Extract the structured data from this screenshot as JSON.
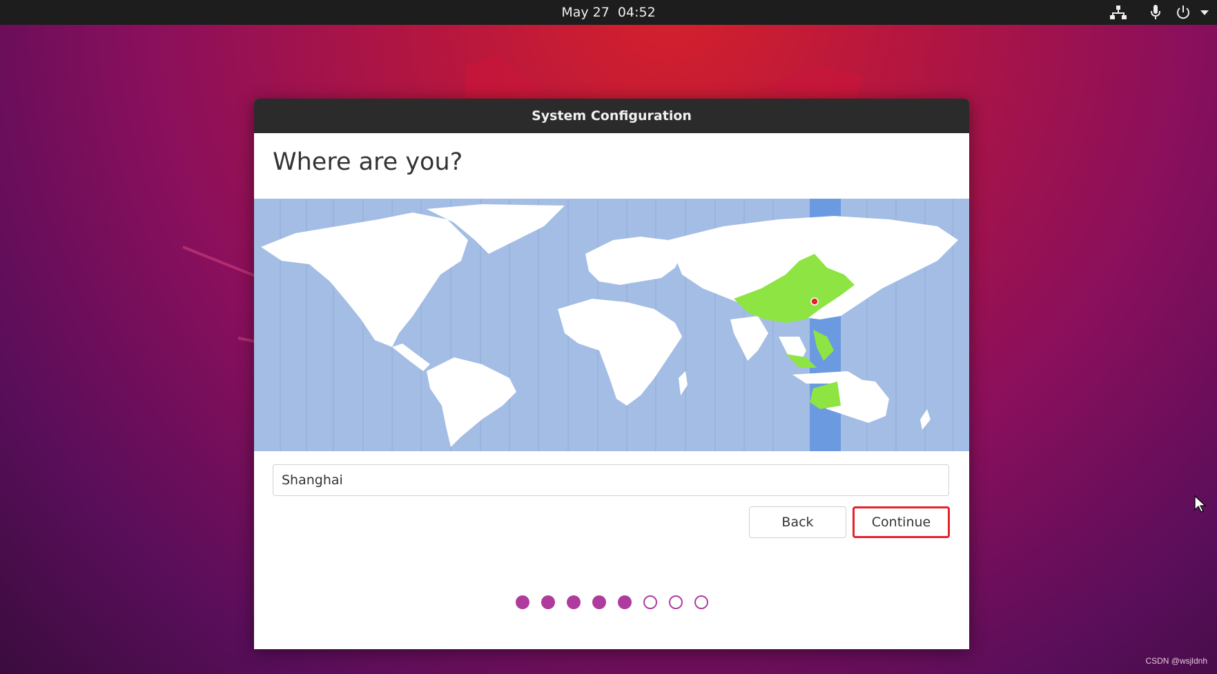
{
  "topbar": {
    "date": "May 27",
    "time": "04:52",
    "icons": [
      "network-icon",
      "microphone-icon",
      "power-icon",
      "chevron-down-icon"
    ]
  },
  "dialog": {
    "title": "System Configuration",
    "heading": "Where are you?",
    "map": {
      "highlight_color": "#8ee443",
      "selected_timezone_band_color": "#6c9ae1",
      "ocean_color": "#a4bde4",
      "selected_marker_color": "#e5212b"
    },
    "timezone_input": {
      "value": "Shanghai",
      "placeholder": ""
    },
    "buttons": {
      "back": "Back",
      "continue": "Continue"
    },
    "progress": {
      "total_steps": 8,
      "completed_steps": 5,
      "accent_color": "#b03b9e"
    }
  },
  "watermark": "CSDN @wsjldnh"
}
